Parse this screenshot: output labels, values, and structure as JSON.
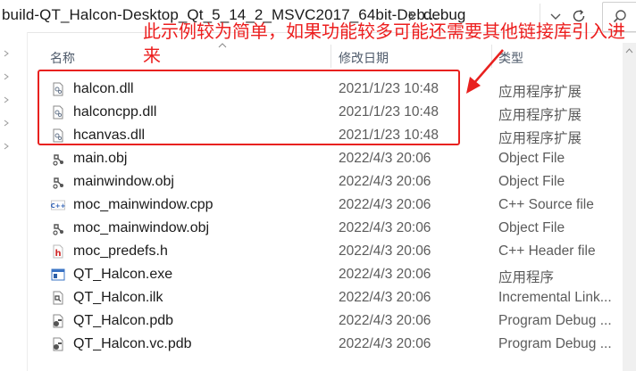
{
  "address_bar": {
    "path_segment": "build-QT_Halcon-Desktop_Qt_5_14_2_MSVC2017_64bit-Deb...",
    "current_folder": "debug"
  },
  "columns": {
    "name": "名称",
    "modified": "修改日期",
    "type": "类型"
  },
  "annotation": {
    "text": "此示例较为简单，如果功能较多可能还需要其他链接库引入进来",
    "color": "#e8211f"
  },
  "files": [
    {
      "name": "halcon.dll",
      "modified": "2021/1/23 10:48",
      "type": "应用程序扩展",
      "icon": "dll-file-icon"
    },
    {
      "name": "halconcpp.dll",
      "modified": "2021/1/23 10:48",
      "type": "应用程序扩展",
      "icon": "dll-file-icon"
    },
    {
      "name": "hcanvas.dll",
      "modified": "2021/1/23 10:48",
      "type": "应用程序扩展",
      "icon": "dll-file-icon"
    },
    {
      "name": "main.obj",
      "modified": "2022/4/3 20:06",
      "type": "Object File",
      "icon": "obj-file-icon"
    },
    {
      "name": "mainwindow.obj",
      "modified": "2022/4/3 20:06",
      "type": "Object File",
      "icon": "obj-file-icon"
    },
    {
      "name": "moc_mainwindow.cpp",
      "modified": "2022/4/3 20:06",
      "type": "C++ Source file",
      "icon": "cpp-file-icon"
    },
    {
      "name": "moc_mainwindow.obj",
      "modified": "2022/4/3 20:06",
      "type": "Object File",
      "icon": "obj-file-icon"
    },
    {
      "name": "moc_predefs.h",
      "modified": "2022/4/3 20:06",
      "type": "C++ Header file",
      "icon": "header-file-icon"
    },
    {
      "name": "QT_Halcon.exe",
      "modified": "2022/4/3 20:06",
      "type": "应用程序",
      "icon": "exe-file-icon"
    },
    {
      "name": "QT_Halcon.ilk",
      "modified": "2022/4/3 20:06",
      "type": "Incremental Link...",
      "icon": "ilk-file-icon"
    },
    {
      "name": "QT_Halcon.pdb",
      "modified": "2022/4/3 20:06",
      "type": "Program Debug ...",
      "icon": "pdb-file-icon"
    },
    {
      "name": "QT_Halcon.vc.pdb",
      "modified": "2022/4/3 20:06",
      "type": "Program Debug ...",
      "icon": "pdb-file-icon"
    }
  ]
}
